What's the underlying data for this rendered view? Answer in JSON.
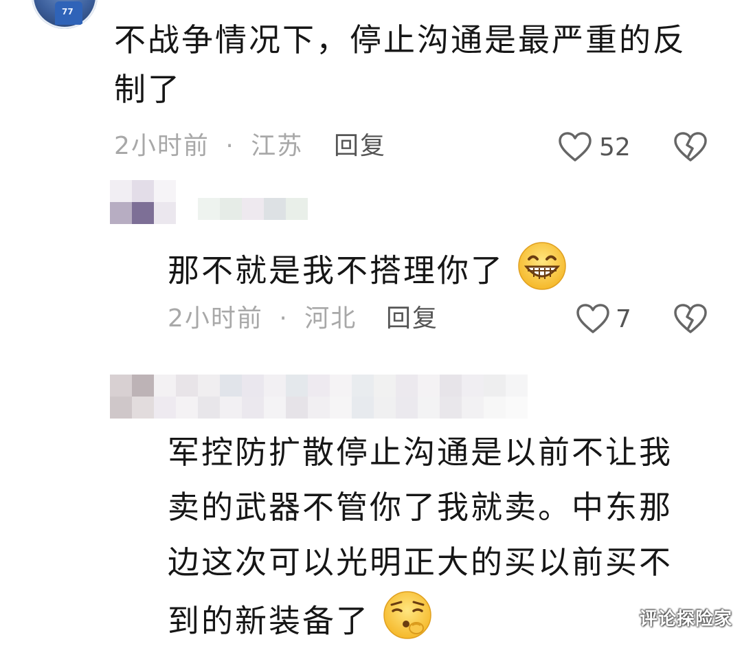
{
  "comments": [
    {
      "text": "不战争情况下，停止沟通是最严重的反制了",
      "time": "2小时前",
      "separator": "·",
      "location": "江苏",
      "reply_label": "回复",
      "likes": "52"
    },
    {
      "text": "那不就是我不搭理你了",
      "emoji": "grinning-face-emoji",
      "time": "2小时前",
      "separator": "·",
      "location": "河北",
      "reply_label": "回复",
      "likes": "7"
    },
    {
      "text": "军控防扩散停止沟通是以前不让我卖的武器不管你了我就卖。中东那边这次可以光明正大的买以前买不到的新装备了",
      "emoji": "smirking-face-emoji"
    }
  ],
  "icons": {
    "like": "heart-outline-icon",
    "dislike": "broken-heart-icon"
  },
  "colors": {
    "text": "#161616",
    "meta": "#a8a8a8",
    "reply": "#555555",
    "icon": "#666666"
  },
  "watermark": "评论探险家"
}
